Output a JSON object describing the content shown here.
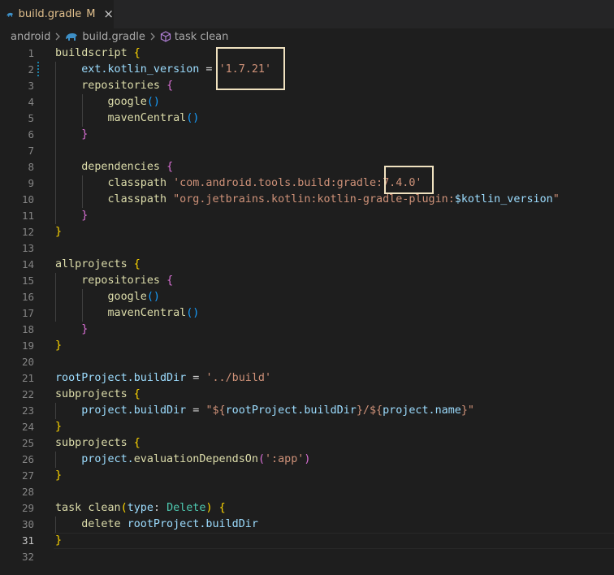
{
  "tab": {
    "label": "build.gradle",
    "modified": "M",
    "close": "×"
  },
  "breadcrumbs": {
    "folder": "android",
    "file": "build.gradle",
    "symbol": "task clean"
  },
  "colors": {
    "string": "#ce9178",
    "keyword": "#dcdcaa",
    "variable": "#9cdcfe",
    "type": "#4ec9b0",
    "highlight_box": "#f0e2c0"
  },
  "editor": {
    "active_line": 31,
    "lines": [
      [
        [
          "k",
          "buildscript"
        ],
        [
          "o",
          " "
        ],
        [
          "b1",
          "{"
        ]
      ],
      [
        [
          "o",
          "    "
        ],
        [
          "v",
          "ext.kotlin_version"
        ],
        [
          "o",
          " = "
        ],
        [
          "s",
          "'1.7.21'"
        ]
      ],
      [
        [
          "o",
          "    "
        ],
        [
          "k",
          "repositories"
        ],
        [
          "o",
          " "
        ],
        [
          "b2",
          "{"
        ]
      ],
      [
        [
          "o",
          "        "
        ],
        [
          "k",
          "google"
        ],
        [
          "b3",
          "()"
        ]
      ],
      [
        [
          "o",
          "        "
        ],
        [
          "k",
          "mavenCentral"
        ],
        [
          "b3",
          "()"
        ]
      ],
      [
        [
          "o",
          "    "
        ],
        [
          "b2",
          "}"
        ]
      ],
      [],
      [
        [
          "o",
          "    "
        ],
        [
          "k",
          "dependencies"
        ],
        [
          "o",
          " "
        ],
        [
          "b2",
          "{"
        ]
      ],
      [
        [
          "o",
          "        "
        ],
        [
          "k",
          "classpath"
        ],
        [
          "o",
          " "
        ],
        [
          "s",
          "'com.android.tools.build:gradle:7.4.0'"
        ]
      ],
      [
        [
          "o",
          "        "
        ],
        [
          "k",
          "classpath"
        ],
        [
          "o",
          " "
        ],
        [
          "s",
          "\"org.jetbrains.kotlin:kotlin-gradle-plugin:"
        ],
        [
          "v",
          "$kotlin_version"
        ],
        [
          "s",
          "\""
        ]
      ],
      [
        [
          "o",
          "    "
        ],
        [
          "b2",
          "}"
        ]
      ],
      [
        [
          "b1",
          "}"
        ]
      ],
      [],
      [
        [
          "k",
          "allprojects"
        ],
        [
          "o",
          " "
        ],
        [
          "b1",
          "{"
        ]
      ],
      [
        [
          "o",
          "    "
        ],
        [
          "k",
          "repositories"
        ],
        [
          "o",
          " "
        ],
        [
          "b2",
          "{"
        ]
      ],
      [
        [
          "o",
          "        "
        ],
        [
          "k",
          "google"
        ],
        [
          "b3",
          "()"
        ]
      ],
      [
        [
          "o",
          "        "
        ],
        [
          "k",
          "mavenCentral"
        ],
        [
          "b3",
          "()"
        ]
      ],
      [
        [
          "o",
          "    "
        ],
        [
          "b2",
          "}"
        ]
      ],
      [
        [
          "b1",
          "}"
        ]
      ],
      [],
      [
        [
          "v",
          "rootProject.buildDir"
        ],
        [
          "o",
          " = "
        ],
        [
          "s",
          "'../build'"
        ]
      ],
      [
        [
          "k",
          "subprojects"
        ],
        [
          "o",
          " "
        ],
        [
          "b1",
          "{"
        ]
      ],
      [
        [
          "o",
          "    "
        ],
        [
          "v",
          "project.buildDir"
        ],
        [
          "o",
          " = "
        ],
        [
          "s",
          "\"${"
        ],
        [
          "v",
          "rootProject.buildDir"
        ],
        [
          "s",
          "}/${"
        ],
        [
          "v",
          "project.name"
        ],
        [
          "s",
          "}\""
        ]
      ],
      [
        [
          "b1",
          "}"
        ]
      ],
      [
        [
          "k",
          "subprojects"
        ],
        [
          "o",
          " "
        ],
        [
          "b1",
          "{"
        ]
      ],
      [
        [
          "o",
          "    "
        ],
        [
          "v",
          "project."
        ],
        [
          "k",
          "evaluationDependsOn"
        ],
        [
          "b2",
          "("
        ],
        [
          "s",
          "':app'"
        ],
        [
          "b2",
          ")"
        ]
      ],
      [
        [
          "b1",
          "}"
        ]
      ],
      [],
      [
        [
          "k",
          "task"
        ],
        [
          "o",
          " "
        ],
        [
          "k",
          "clean"
        ],
        [
          "b1",
          "("
        ],
        [
          "v",
          "type"
        ],
        [
          "o",
          ": "
        ],
        [
          "t",
          "Delete"
        ],
        [
          "b1",
          ")"
        ],
        [
          "o",
          " "
        ],
        [
          "b1",
          "{"
        ]
      ],
      [
        [
          "o",
          "    "
        ],
        [
          "k",
          "delete"
        ],
        [
          "o",
          " "
        ],
        [
          "v",
          "rootProject.buildDir"
        ]
      ],
      [
        [
          "b1",
          "}"
        ]
      ],
      []
    ]
  }
}
